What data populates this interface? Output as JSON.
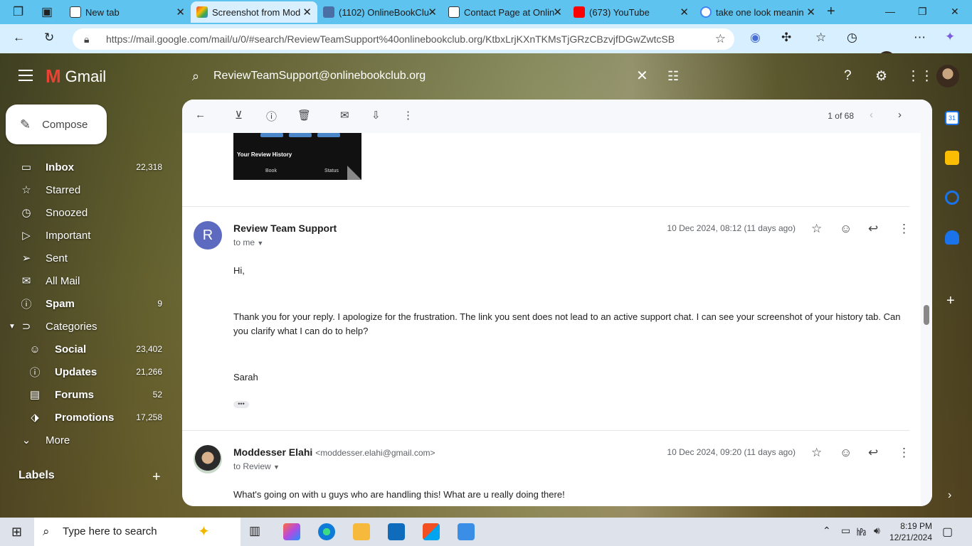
{
  "browser": {
    "tabs": [
      {
        "title": "New tab",
        "icon": "new-tab-icon",
        "active": false
      },
      {
        "title": "Screenshot from Mod",
        "icon": "gmail-icon",
        "active": true
      },
      {
        "title": "(1102) OnlineBookClu",
        "icon": "book-icon",
        "active": false
      },
      {
        "title": "Contact Page at Onlin",
        "icon": "b-logo-icon",
        "active": false
      },
      {
        "title": "(673) YouTube",
        "icon": "youtube-icon",
        "active": false
      },
      {
        "title": "take one look meanin",
        "icon": "google-icon",
        "active": false
      }
    ],
    "url": "https://mail.google.com/mail/u/0/#search/ReviewTeamSupport%40onlinebookclub.org/KtbxLrjKXnTKMsTjGRzCBzvjfDGwZwtcSB"
  },
  "gmail": {
    "logo_text": "Gmail",
    "search_query": "ReviewTeamSupport@onlinebookclub.org",
    "compose_label": "Compose",
    "nav": [
      {
        "label": "Inbox",
        "count": "22,318",
        "icon": "inbox-icon",
        "bold": true
      },
      {
        "label": "Starred",
        "count": "",
        "icon": "star-icon",
        "bold": false
      },
      {
        "label": "Snoozed",
        "count": "",
        "icon": "clock-icon",
        "bold": false
      },
      {
        "label": "Important",
        "count": "",
        "icon": "important-icon",
        "bold": false
      },
      {
        "label": "Sent",
        "count": "",
        "icon": "send-icon",
        "bold": false
      },
      {
        "label": "All Mail",
        "count": "",
        "icon": "all-mail-icon",
        "bold": false
      },
      {
        "label": "Spam",
        "count": "9",
        "icon": "spam-icon",
        "bold": true
      },
      {
        "label": "Categories",
        "count": "",
        "icon": "label-icon",
        "bold": false
      }
    ],
    "categories": [
      {
        "label": "Social",
        "count": "23,402",
        "icon": "people-icon"
      },
      {
        "label": "Updates",
        "count": "21,266",
        "icon": "info-icon"
      },
      {
        "label": "Forums",
        "count": "52",
        "icon": "forum-icon"
      },
      {
        "label": "Promotions",
        "count": "17,258",
        "icon": "tag-icon"
      }
    ],
    "more_label": "More",
    "labels_title": "Labels",
    "pager": "1 of 68",
    "preview": {
      "heading": "Your Review History",
      "col1": "Book",
      "col2": "Status"
    },
    "messages": [
      {
        "sender": "Review Team Support",
        "sender_email": "",
        "avatar_letter": "R",
        "to": "to me",
        "date": "10 Dec 2024, 08:12 (11 days ago)",
        "greeting": "Hi,",
        "body": "Thank you for your reply. I apologize for the frustration. The link you sent does not lead to an active support chat. I can see your screenshot of your history tab. Can you clarify what I can do to help?",
        "signature": "Sarah"
      },
      {
        "sender": "Moddesser Elahi",
        "sender_email": "<moddesser.elahi@gmail.com>",
        "to": "to Review",
        "date": "10 Dec 2024, 09:20 (11 days ago)",
        "body": "What's going on with u guys who are handling this! What are u really doing there!"
      }
    ]
  },
  "taskbar": {
    "search_placeholder": "Type here to search",
    "time": "8:19 PM",
    "date": "12/21/2024"
  },
  "colors": {
    "tabbar": "#5ec3ef",
    "addressbar": "#d7efff",
    "avatar_r": "#5c6bc0"
  }
}
